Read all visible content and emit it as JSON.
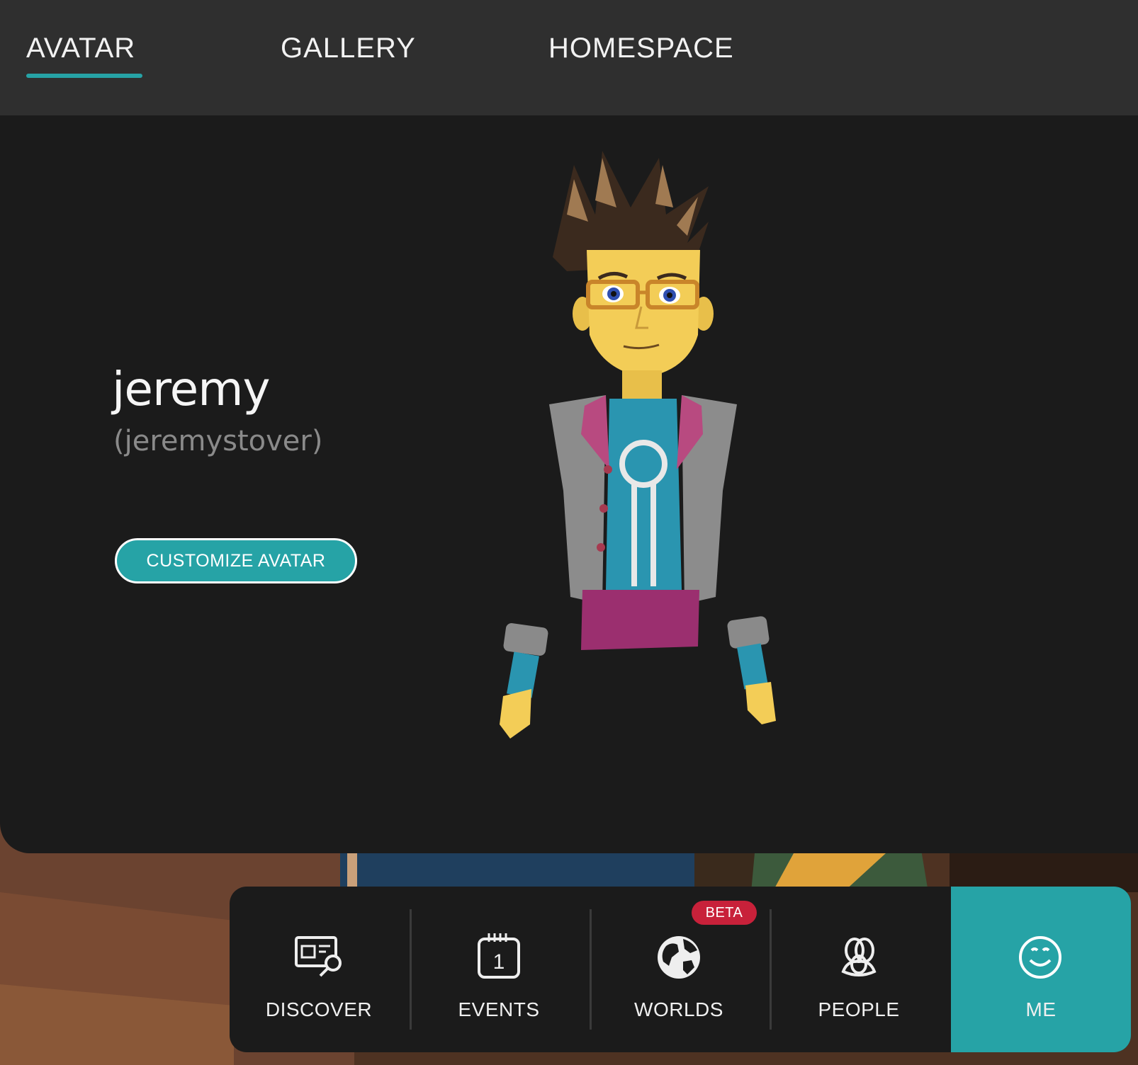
{
  "tabs": [
    {
      "label": "AVATAR",
      "active": true
    },
    {
      "label": "GALLERY",
      "active": false
    },
    {
      "label": "HOMESPACE",
      "active": false
    }
  ],
  "profile": {
    "display_name": "jeremy",
    "username": "(jeremystover)",
    "customize_label": "CUSTOMIZE AVATAR"
  },
  "bottom_nav": {
    "items": [
      {
        "label": "DISCOVER",
        "icon": "discover-icon"
      },
      {
        "label": "EVENTS",
        "icon": "calendar-icon"
      },
      {
        "label": "WORLDS",
        "icon": "globe-icon",
        "badge": "BETA"
      },
      {
        "label": "PEOPLE",
        "icon": "people-icon"
      },
      {
        "label": "ME",
        "icon": "smiley-icon",
        "active": true
      }
    ]
  },
  "colors": {
    "accent": "#26a3a6",
    "badge": "#c8213a",
    "panel": "#1b1b1b",
    "topbar": "#2f2f2f"
  }
}
